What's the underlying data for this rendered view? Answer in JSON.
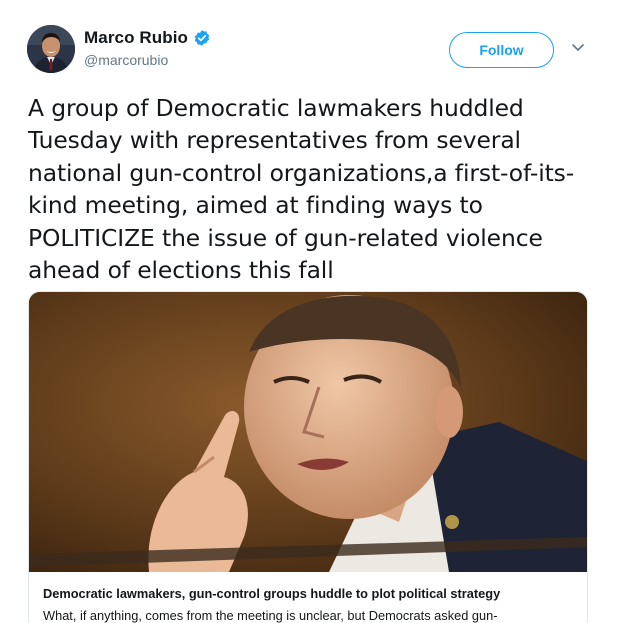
{
  "author": {
    "display_name": "Marco Rubio",
    "handle": "@marcorubio",
    "verified": true
  },
  "actions": {
    "follow_label": "Follow",
    "more_icon": "chevron-down-icon"
  },
  "tweet": {
    "text": "A group of Democratic lawmakers huddled Tuesday with representatives from several national gun-control organizations,a first-of-its-kind meeting, aimed at finding ways to POLITICIZE the issue of gun-related violence ahead of elections this fall"
  },
  "link_card": {
    "title": "Democratic lawmakers, gun-control groups huddle to plot political strategy",
    "description": "What, if anything, comes from the meeting is unclear, but Democrats asked gun-"
  },
  "colors": {
    "accent": "#1da1f2",
    "text": "#14171a",
    "secondary_text": "#657786",
    "border": "#e1e8ed"
  }
}
